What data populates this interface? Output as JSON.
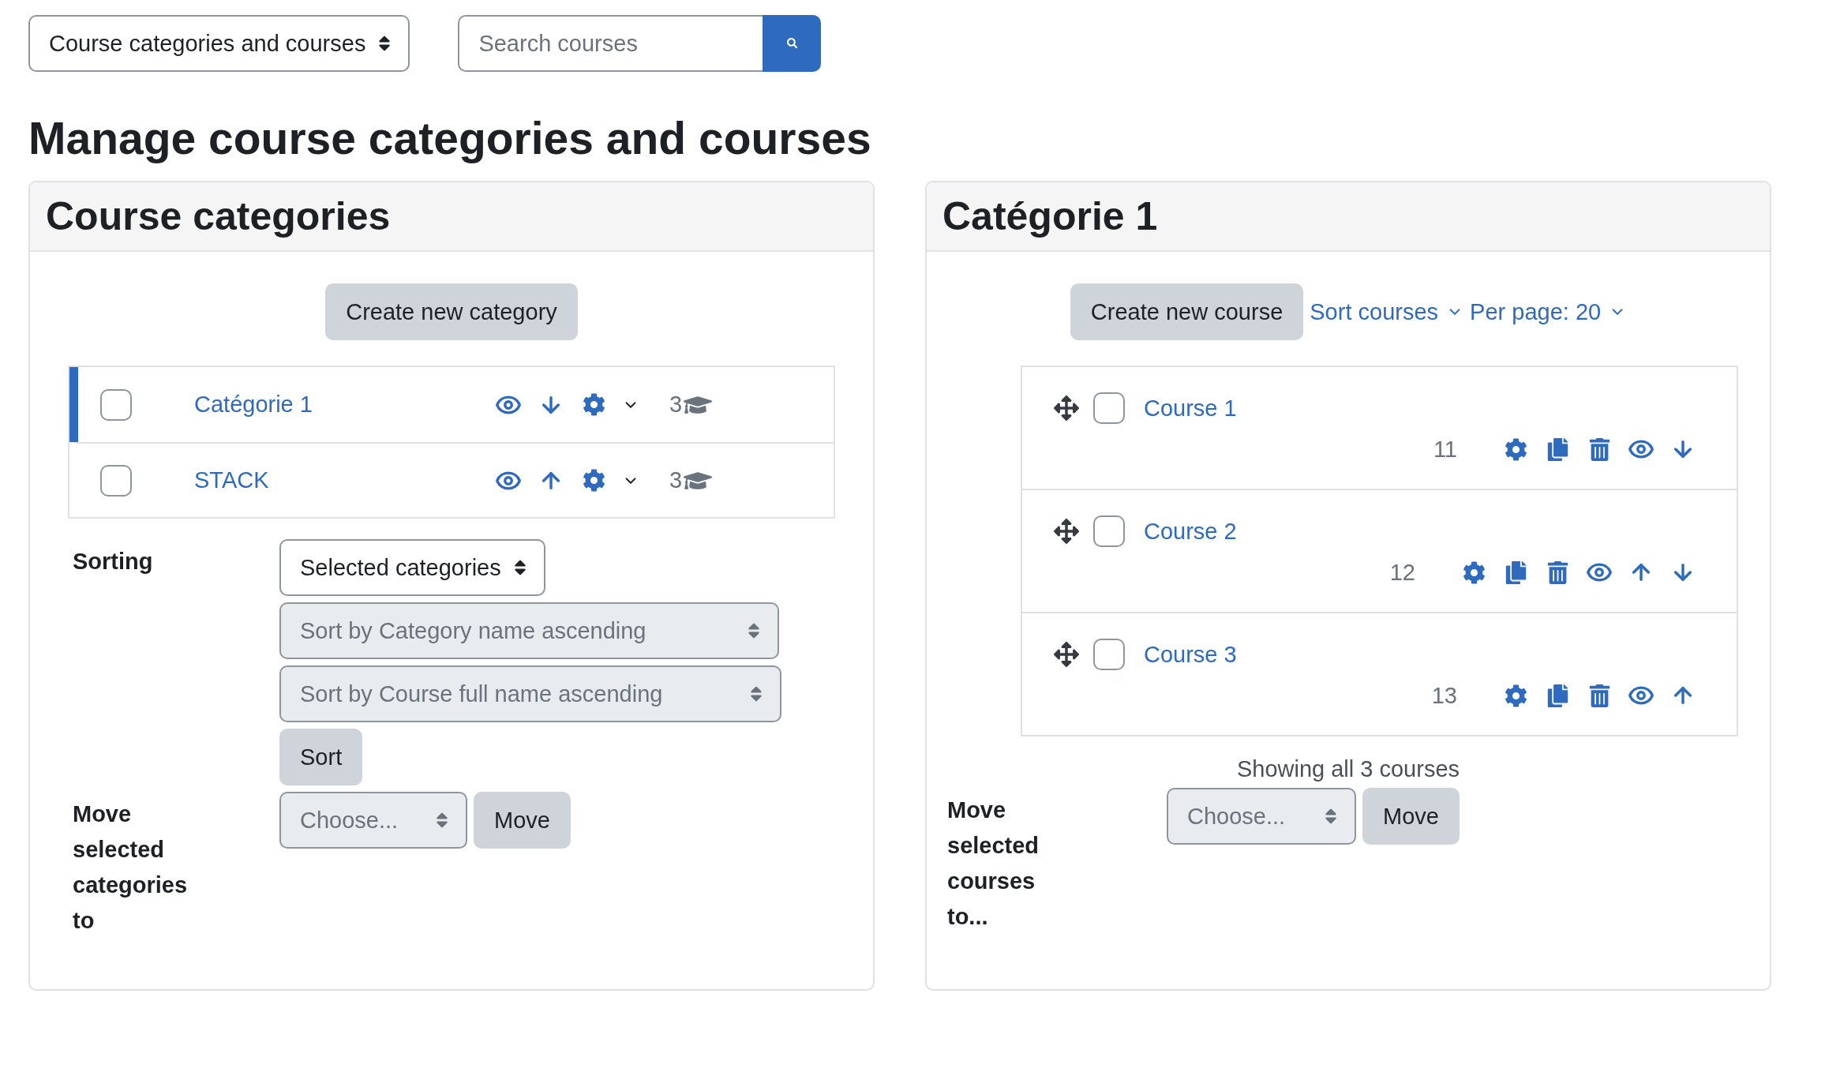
{
  "view_select": {
    "value": "Course categories and courses"
  },
  "search": {
    "placeholder": "Search courses"
  },
  "heading": "Manage course categories and courses",
  "categories_panel": {
    "title": "Course categories",
    "create_button": "Create new category",
    "categories": [
      {
        "name": "Catégorie 1",
        "selected": true,
        "checked": false,
        "actions": [
          {
            "kind": "visibility"
          },
          {
            "kind": "down"
          },
          {
            "kind": "settings"
          }
        ],
        "count": "3"
      },
      {
        "name": "STACK",
        "selected": false,
        "checked": false,
        "actions": [
          {
            "kind": "visibility"
          },
          {
            "kind": "up"
          },
          {
            "kind": "settings"
          }
        ],
        "count": "3"
      }
    ],
    "sorting_label": "Sorting",
    "sort_scope": {
      "value": "Selected categories"
    },
    "sort_categories": {
      "value": "Sort by Category name ascending",
      "disabled": true
    },
    "sort_courses": {
      "value": "Sort by Course full name ascending",
      "disabled": true
    },
    "sort_button": "Sort",
    "move_label": "Move selected categories to",
    "move_select": {
      "placeholder": "Choose...",
      "disabled": true
    },
    "move_button": "Move"
  },
  "courses_panel": {
    "title": "Catégorie 1",
    "create_button": "Create new course",
    "sort_link": "Sort courses",
    "per_page_link": "Per page: 20",
    "courses": [
      {
        "name": "Course 1",
        "checked": false,
        "count": "11",
        "actions": [
          {
            "kind": "settings"
          },
          {
            "kind": "copy"
          },
          {
            "kind": "delete"
          },
          {
            "kind": "visibility"
          },
          {
            "kind": "down"
          }
        ]
      },
      {
        "name": "Course 2",
        "checked": false,
        "count": "12",
        "actions": [
          {
            "kind": "settings"
          },
          {
            "kind": "copy"
          },
          {
            "kind": "delete"
          },
          {
            "kind": "visibility"
          },
          {
            "kind": "up"
          },
          {
            "kind": "down"
          }
        ]
      },
      {
        "name": "Course 3",
        "checked": false,
        "count": "13",
        "actions": [
          {
            "kind": "settings"
          },
          {
            "kind": "copy"
          },
          {
            "kind": "delete"
          },
          {
            "kind": "visibility"
          },
          {
            "kind": "up"
          }
        ]
      }
    ],
    "summary": "Showing all 3 courses",
    "move_label": "Move selected courses to...",
    "move_select": {
      "placeholder": "Choose...",
      "disabled": true
    },
    "move_button": "Move"
  }
}
